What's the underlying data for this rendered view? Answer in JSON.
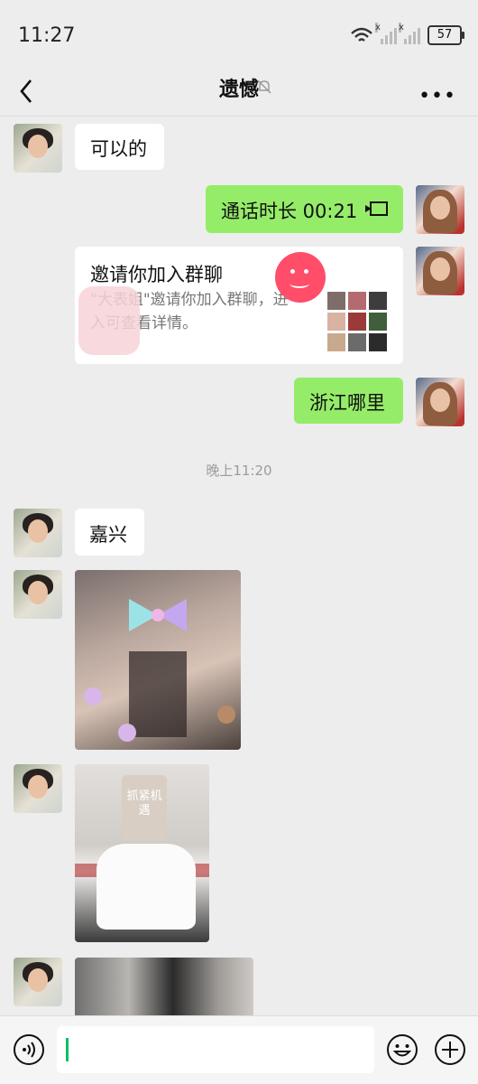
{
  "status": {
    "time": "11:27",
    "battery": "57"
  },
  "header": {
    "title": "遗憾"
  },
  "messages": [
    {
      "text": "可以的"
    },
    {
      "text": "通话时长 00:21"
    },
    {
      "invite_title": "邀请你加入群聊",
      "invite_desc": "\"大表姐\"邀请你加入群聊，进入可查看详情。"
    },
    {
      "text": "浙江哪里"
    },
    {
      "time_label": "晚上11:20"
    },
    {
      "text": "嘉兴"
    },
    {
      "image_caption": "抓紧机遇"
    }
  ],
  "input": {
    "placeholder": ""
  },
  "colors": {
    "background": "#ededed",
    "outgoing_bubble": "#95ec69",
    "incoming_bubble": "#ffffff",
    "caret": "#07c160"
  },
  "icons": [
    "back-icon",
    "mute-bell-icon",
    "more-icon",
    "voice-icon",
    "video-call-icon",
    "emoji-icon",
    "plus-icon"
  ]
}
